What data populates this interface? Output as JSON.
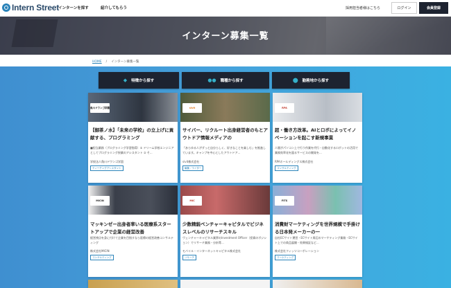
{
  "header": {
    "logo": "Intern Street",
    "nav": [
      "インターンを探す",
      "紹介してもらう"
    ],
    "recruiter_link": "採用担当者様はこちら",
    "login": "ログイン",
    "signup": "会員登録"
  },
  "hero": {
    "title": "インターン募集一覧"
  },
  "breadcrumb": {
    "home": "HOME",
    "sep": "/",
    "current": "インターン募集一覧"
  },
  "search": [
    {
      "icon": "tag-icon",
      "glyph": "◆",
      "label": "特徴から探す"
    },
    {
      "icon": "people-icon",
      "glyph": "●●",
      "label": "職種から探す"
    },
    {
      "icon": "map-pin-icon",
      "glyph": "⬤",
      "label": "勤務地から探す"
    }
  ],
  "cards": [
    {
      "title": "【御茶ノ水】「未来の学校」の立上げに貢献する、プログラミング",
      "desc": "■担当業務（プログラミング学習指導）① ドリーム学校エンジニアとしてプログラミング授業のアシスタント ② そ...",
      "company": "学校法人角川ドワンゴ学園",
      "tag": "ティーチングアシスタント",
      "badge": "角川ドワンゴ学園",
      "img_color": "#4d5a6a"
    },
    {
      "title": "サイバー、リクルート出身経営者のもとアウトドア情報メディアの",
      "desc": "「あらゆる人がずっと自分らしく、好きなことを楽しむ」を推進しています。キャンプを中心としたアウトドア...",
      "company": "sivit株式会社",
      "tag": "編集／ライター",
      "badge": "sivit",
      "img_color": "#6b7a5a"
    },
    {
      "title": "超・働き方改革。AIとロボによってイノベーションを起こす新規事業",
      "desc": "人間がパソコン上で行う作業を代行・自動化するロボットの活用で業務効率化を図るサービスの開発を...",
      "company": "RPAホールディングス株式会社",
      "tag": "コンサルティング",
      "badge": "RPA",
      "img_color": "#c8cdd4"
    },
    {
      "title": "マッキンゼー出身者率いる医療系スタートアップで企業の経営改善",
      "desc": "経営視点を身に付けて企業を目指すなら医療の経営改善コンサルティング",
      "company": "株式会社MICIN",
      "tag": "コンサルティング",
      "badge": "MICIN",
      "img_color": "#3a3f4a"
    },
    {
      "title": "少数精鋭ベンチャーキャピタルでビジネスレベルのリサーチスキル",
      "desc": "ヴェンチャーキャピタル業界のInvestment Officer（投資のポジション）でリサーチ業務・分析等...",
      "company": "モバイル・インターネットキャピタル株式会社",
      "tag": "リサーチ",
      "badge": "MIC",
      "img_color": "#8a4a4a"
    },
    {
      "title": "消費財マーケティングを世界規模で手掛ける日本発メーカーの一",
      "desc": "自社ECサイト運営・ECサイト周辺のマーケティング業務・ECサイト上での商品展開・効果検証など...",
      "company": "株式会社フィッツコーポレーション",
      "tag": "マーケティング",
      "badge": "FITS",
      "img_color": "#7fa0c0"
    }
  ]
}
